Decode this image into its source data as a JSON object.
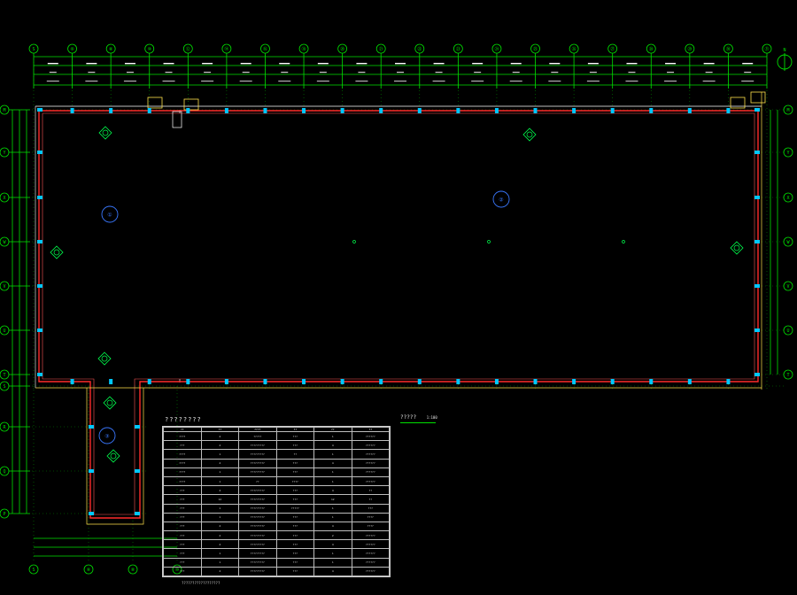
{
  "drawing": {
    "colors": {
      "background": "#000000",
      "grid_line": "#00e000",
      "wall": "#ff2a2a",
      "column": "#00c8ff",
      "dashed": "#9a9a9a",
      "room_tag": "#3a78ff",
      "fixture": "#00ff4c",
      "dimension": "#ffffff"
    },
    "top_axis_labels": [
      "S",
      "⑥",
      "⑧",
      "⑩",
      "⑫",
      "⑭",
      "⑯",
      "⑱",
      "⑳",
      "㉑",
      "㉒",
      "㉓",
      "㉔",
      "㉕",
      "㉖",
      "㉗",
      "㉘",
      "㉙",
      "㉚",
      "㉛"
    ],
    "left_axis_labels": [
      "M",
      "Y",
      "X",
      "W",
      "V",
      "U",
      "T",
      "S",
      "R",
      "Q",
      "P"
    ],
    "bottom_axis_labels": [
      "S",
      "⑥",
      "⑧",
      "⑩"
    ],
    "room_tags": [
      "①",
      "②",
      "③"
    ],
    "north_symbol": "N"
  },
  "schedule": {
    "title": "????????",
    "columns": [
      "??",
      "??",
      "????",
      "??",
      "??",
      "??"
    ],
    "rows": [
      [
        "????",
        "4",
        "?????",
        "???",
        "1",
        "??????"
      ],
      [
        "???",
        "4",
        "?????????",
        "???",
        "4",
        "??????"
      ],
      [
        "????",
        "1",
        "?????????",
        "??",
        "1",
        "??????"
      ],
      [
        "????",
        "4",
        "?????????",
        "???",
        "4",
        "??????"
      ],
      [
        "????",
        "1",
        "?????????",
        "???",
        "1",
        "??????"
      ],
      [
        "????",
        "1",
        "??",
        "????",
        "1",
        "??????"
      ],
      [
        "???",
        "4",
        "?????????",
        "???",
        "4",
        "??"
      ],
      [
        "???",
        "12",
        "?????????",
        "???",
        "12",
        "??"
      ],
      [
        "???",
        "1",
        "?????????",
        "?????",
        "1",
        "???"
      ],
      [
        "???",
        "1",
        "?????????",
        "???",
        "1",
        "????"
      ],
      [
        "???",
        "4",
        "?????????",
        "???",
        "4",
        "????"
      ],
      [
        "???",
        "2",
        "?????????",
        "???",
        "2",
        "??????"
      ],
      [
        "???",
        "4",
        "?????????",
        "???",
        "4",
        "??????"
      ],
      [
        "???",
        "1",
        "?????????",
        "???",
        "1",
        "??????"
      ],
      [
        "???",
        "1",
        "?????????",
        "???",
        "1",
        "??????"
      ],
      [
        "???",
        "4",
        "?????????",
        "???",
        "4",
        "??????"
      ]
    ]
  },
  "plan_title": {
    "text": "?????",
    "scale": "1:100"
  },
  "footnote": "??????????????????"
}
